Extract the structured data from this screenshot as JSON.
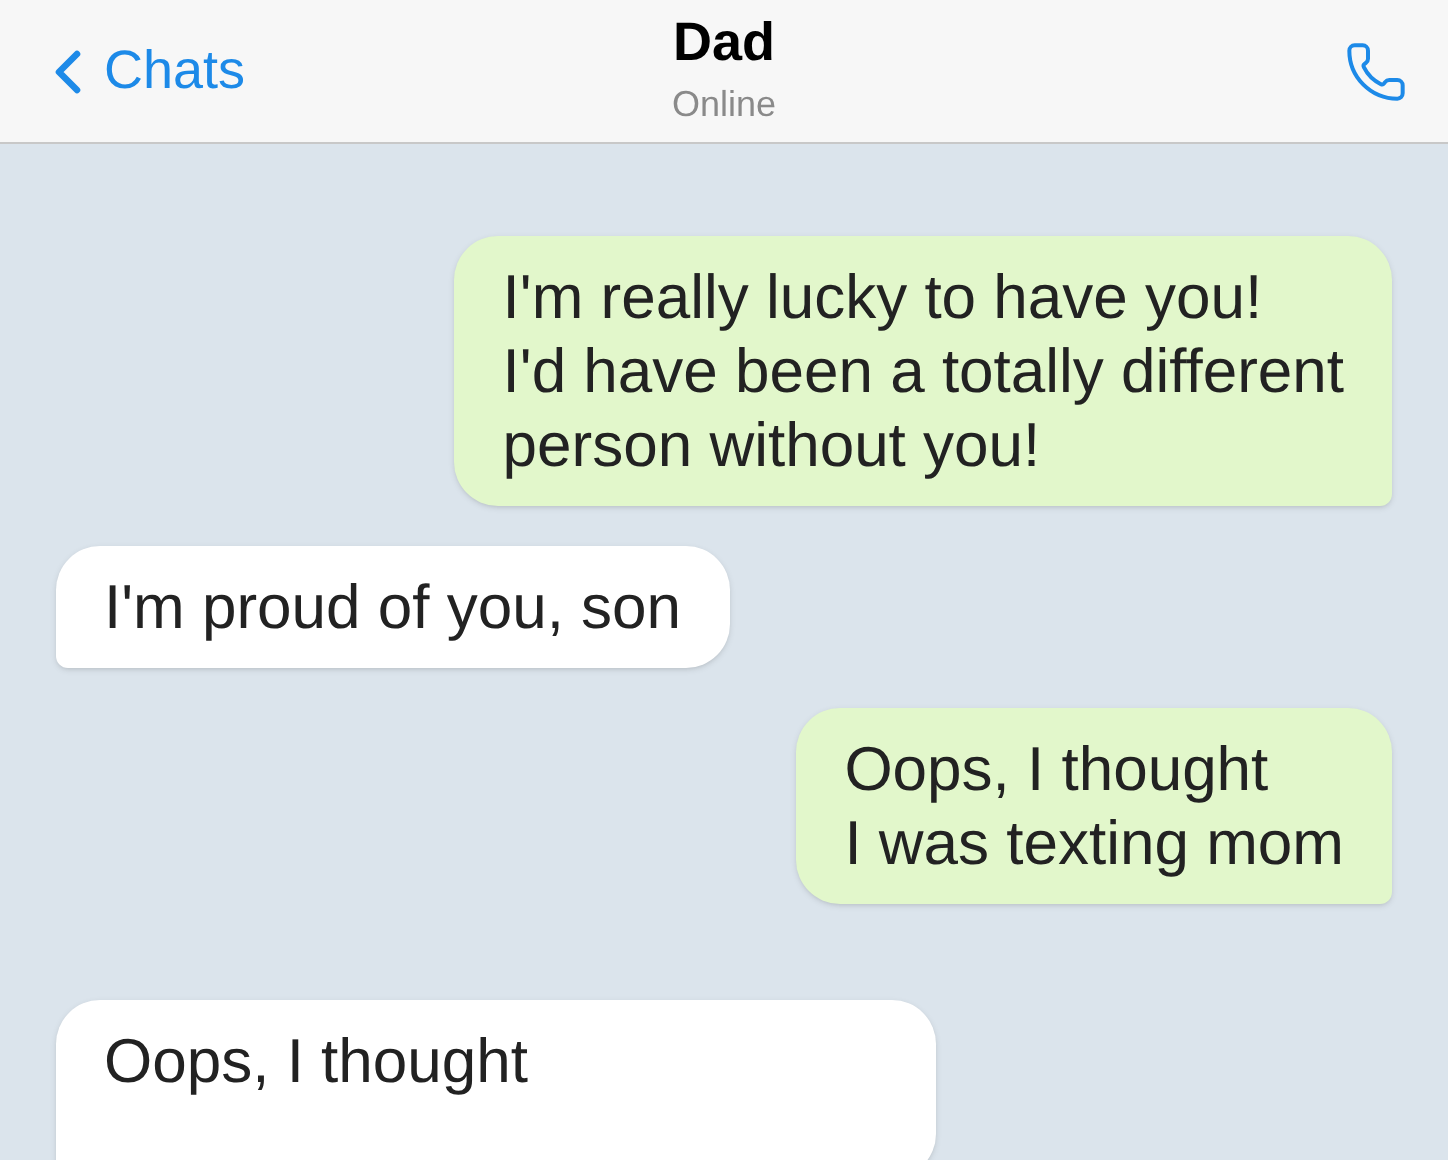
{
  "header": {
    "back_label": "Chats",
    "title": "Dad",
    "status": "Online"
  },
  "messages": [
    {
      "kind": "outgoing",
      "text": "I'm really lucky to have you!\nI'd have been a totally different\nperson without you!"
    },
    {
      "kind": "incoming",
      "text": "I'm proud of you, son"
    },
    {
      "kind": "outgoing",
      "text": "Oops, I thought\nI was texting mom"
    },
    {
      "kind": "incoming",
      "text": "Oops, I thought"
    }
  ]
}
